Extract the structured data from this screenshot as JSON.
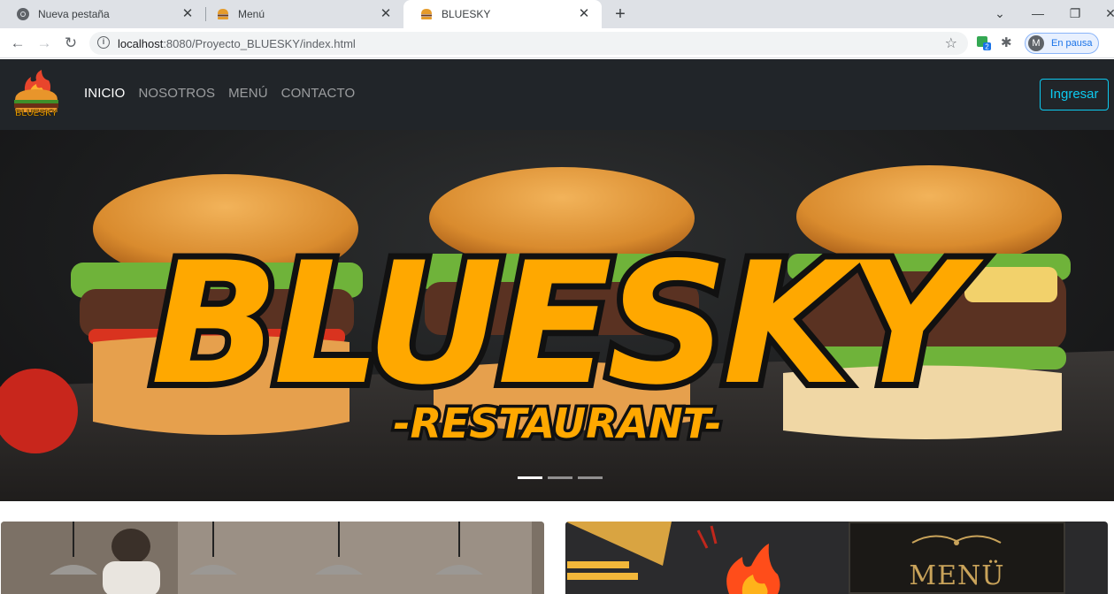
{
  "browser": {
    "tabs": [
      {
        "title": "Nueva pestaña",
        "icon": "chrome-icon",
        "active": false
      },
      {
        "title": "Menú",
        "icon": "burger-favicon",
        "active": false
      },
      {
        "title": "BLUESKY",
        "icon": "burger-favicon",
        "active": true
      }
    ],
    "url_host": "localhost",
    "url_path": ":8080/Proyecto_BLUESKY/index.html",
    "profile": {
      "initial": "M",
      "label": "En pausa"
    },
    "extension_badge": "2"
  },
  "site": {
    "nav": {
      "items": [
        {
          "label": "INICIO",
          "active": true
        },
        {
          "label": "NOSOTROS",
          "active": false
        },
        {
          "label": "MENÚ",
          "active": false
        },
        {
          "label": "CONTACTO",
          "active": false
        }
      ],
      "login_label": "Ingresar"
    },
    "logo_text": "BLUESKY",
    "hero": {
      "title": "BLUESKY",
      "subtitle": "-RESTAURANT-",
      "slides": 3,
      "active_slide": 1
    },
    "cards": {
      "menu_board_text": "MENÜ"
    }
  },
  "colors": {
    "navbar_bg": "#212529",
    "accent_login": "#0dcaf0",
    "hero_text": "#ffa800",
    "hero_outline": "#111111"
  }
}
